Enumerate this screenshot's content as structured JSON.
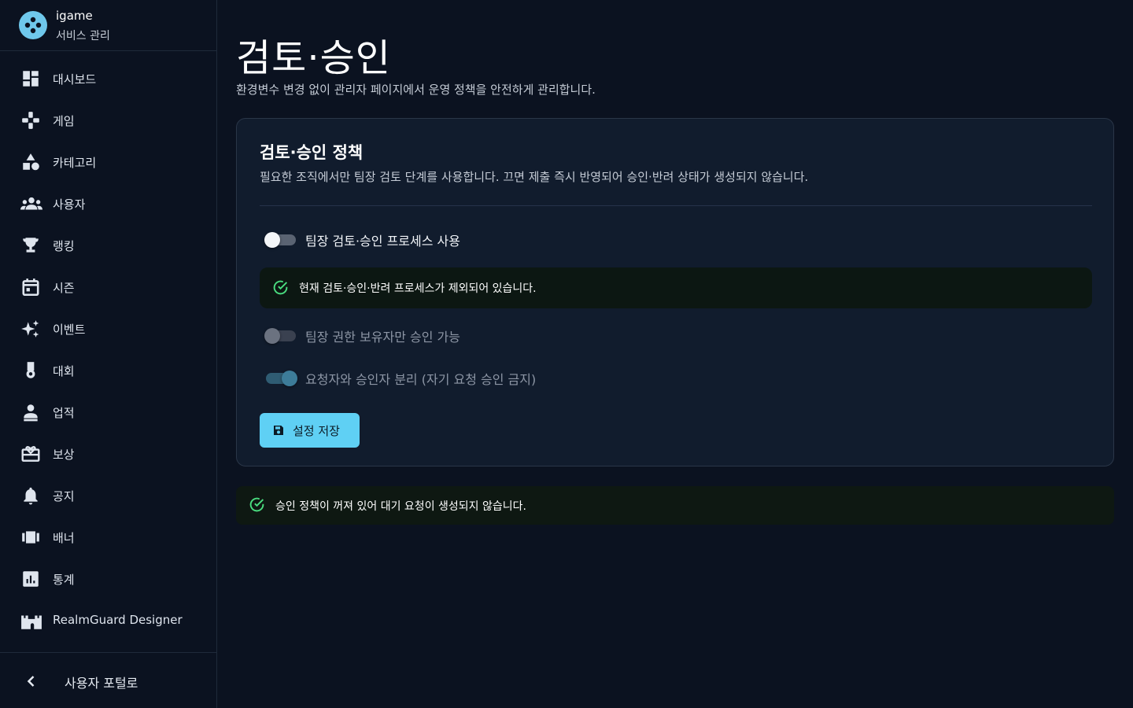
{
  "brand": {
    "name": "igame",
    "subtitle": "서비스 관리",
    "accent": "#6fc8ec"
  },
  "sidebar": {
    "items": [
      {
        "label": "대시보드",
        "icon": "dashboard-icon"
      },
      {
        "label": "게임",
        "icon": "gamepad-icon"
      },
      {
        "label": "카테고리",
        "icon": "category-icon"
      },
      {
        "label": "사용자",
        "icon": "users-icon"
      },
      {
        "label": "랭킹",
        "icon": "trophy-icon"
      },
      {
        "label": "시즌",
        "icon": "calendar-icon"
      },
      {
        "label": "이벤트",
        "icon": "sparkle-icon"
      },
      {
        "label": "대회",
        "icon": "medal-icon"
      },
      {
        "label": "업적",
        "icon": "achievement-icon"
      },
      {
        "label": "보상",
        "icon": "gift-icon"
      },
      {
        "label": "공지",
        "icon": "bell-icon"
      },
      {
        "label": "배너",
        "icon": "banner-icon"
      },
      {
        "label": "통계",
        "icon": "stats-icon"
      },
      {
        "label": "RealmGuard Designer",
        "icon": "castle-icon"
      }
    ],
    "footer_label": "사용자 포털로"
  },
  "page": {
    "title": "검토·승인",
    "subtitle": "환경변수 변경 없이 관리자 페이지에서 운영 정책을 안전하게 관리합니다."
  },
  "card": {
    "title": "검토·승인 정책",
    "description": "필요한 조직에서만 팀장 검토 단계를 사용합니다. 끄면 제출 즉시 반영되어 승인·반려 상태가 생성되지 않습니다.",
    "toggles": [
      {
        "label": "팀장 검토·승인 프로세스 사용",
        "checked": false,
        "disabled": false
      },
      {
        "label": "팀장 권한 보유자만 승인 가능",
        "checked": false,
        "disabled": true
      },
      {
        "label": "요청자와 승인자 분리 (자기 요청 승인 금지)",
        "checked": true,
        "disabled": true
      }
    ],
    "info_alert": "현재 검토·승인·반려 프로세스가 제외되어 있습니다.",
    "save_label": "설정 저장"
  },
  "status_message": "승인 정책이 꺼져 있어 대기 요청이 생성되지 않습니다.",
  "colors": {
    "background": "#0b1220",
    "card": "#111c2d",
    "button": "#5fd0f4",
    "success": "#4ade80"
  }
}
